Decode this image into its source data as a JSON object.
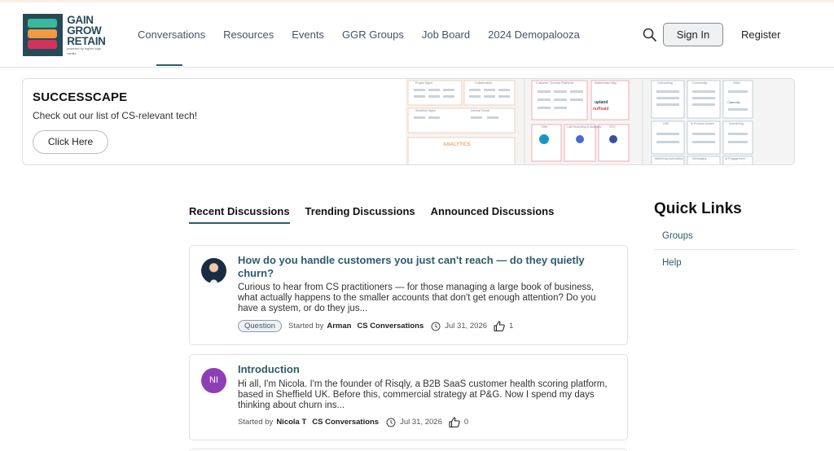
{
  "header": {
    "logo_lines": [
      "GAIN",
      "GROW",
      "RETAIN"
    ],
    "logo_tagline": "powered by higher logic vanilla",
    "nav": [
      "Conversations",
      "Resources",
      "Events",
      "GGR Groups",
      "Job Board",
      "2024 Demopalooza"
    ],
    "active_nav": "Conversations",
    "signin_label": "Sign In",
    "register_label": "Register"
  },
  "banner": {
    "title": "SUCCESSCAPE",
    "subtitle": "Check out our list of CS-relevant tech!",
    "button_label": "Click Here",
    "art_labels": [
      "Project Mgmt",
      "Collaboration",
      "Customer Success Platforms",
      "Stakeholder Map",
      "Onboarding",
      "Community",
      "Video",
      "Workflow Mgmt",
      "Internal Social",
      "ANALYTICS",
      "CRM",
      "Call Recording & Analytics",
      "VOC",
      "LMS",
      "In Product Guides",
      "Scheduling",
      "Marketing Automation",
      "Messaging",
      "AI Engagement",
      "upland",
      "nuffsaid",
      "Calendly"
    ]
  },
  "tabs": [
    "Recent Discussions",
    "Trending Discussions",
    "Announced Discussions"
  ],
  "active_tab": "Recent Discussions",
  "discussions": [
    {
      "title": "How do you handle customers you just can't reach — do they quietly churn?",
      "excerpt": "Curious to hear from CS practitioners — for those managing a large book of business, what actually happens to the smaller accounts that don't get enough attention? Do you have a system, or do they jus...",
      "tag": "Question",
      "started_by_label": "Started by",
      "author": "Arman",
      "category": "CS Conversations",
      "date": "Jul 31, 2026",
      "likes": "1"
    },
    {
      "title": "Introduction",
      "excerpt": "Hi all, I'm Nicola. I'm the founder of Risqly, a B2B SaaS customer health scoring platform, based in Sheffield UK. Before this, commercial strategy at P&G. Now I spend my days thinking about churn ins...",
      "avatar_initials": "NI",
      "started_by_label": "Started by",
      "author": "Nicola T",
      "category": "CS Conversations",
      "date": "Jul 31, 2026",
      "likes": "0"
    }
  ],
  "quick_links": {
    "title": "Quick Links",
    "items": [
      "Groups",
      "Help"
    ]
  },
  "colors": {
    "accent": "#2d5b6b",
    "avatar_purple": "#8e3fb5",
    "logo_navy": "#274a59",
    "logo_teal": "#39b89a",
    "logo_orange": "#f29a42",
    "logo_pink": "#d4325e"
  }
}
